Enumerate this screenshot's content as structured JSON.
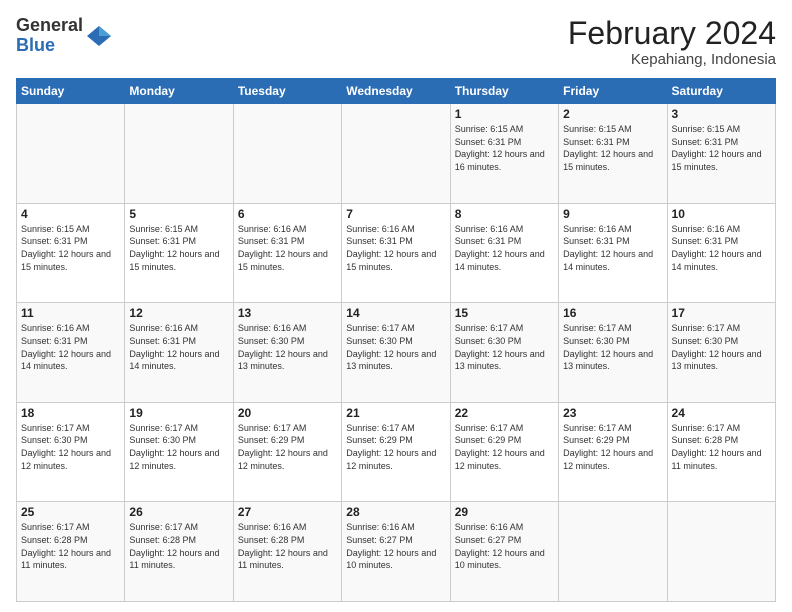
{
  "logo": {
    "text_general": "General",
    "text_blue": "Blue"
  },
  "title": "February 2024",
  "subtitle": "Kepahiang, Indonesia",
  "days_header": [
    "Sunday",
    "Monday",
    "Tuesday",
    "Wednesday",
    "Thursday",
    "Friday",
    "Saturday"
  ],
  "weeks": [
    [
      {
        "num": "",
        "info": ""
      },
      {
        "num": "",
        "info": ""
      },
      {
        "num": "",
        "info": ""
      },
      {
        "num": "",
        "info": ""
      },
      {
        "num": "1",
        "info": "Sunrise: 6:15 AM\nSunset: 6:31 PM\nDaylight: 12 hours and 16 minutes."
      },
      {
        "num": "2",
        "info": "Sunrise: 6:15 AM\nSunset: 6:31 PM\nDaylight: 12 hours and 15 minutes."
      },
      {
        "num": "3",
        "info": "Sunrise: 6:15 AM\nSunset: 6:31 PM\nDaylight: 12 hours and 15 minutes."
      }
    ],
    [
      {
        "num": "4",
        "info": "Sunrise: 6:15 AM\nSunset: 6:31 PM\nDaylight: 12 hours and 15 minutes."
      },
      {
        "num": "5",
        "info": "Sunrise: 6:15 AM\nSunset: 6:31 PM\nDaylight: 12 hours and 15 minutes."
      },
      {
        "num": "6",
        "info": "Sunrise: 6:16 AM\nSunset: 6:31 PM\nDaylight: 12 hours and 15 minutes."
      },
      {
        "num": "7",
        "info": "Sunrise: 6:16 AM\nSunset: 6:31 PM\nDaylight: 12 hours and 15 minutes."
      },
      {
        "num": "8",
        "info": "Sunrise: 6:16 AM\nSunset: 6:31 PM\nDaylight: 12 hours and 14 minutes."
      },
      {
        "num": "9",
        "info": "Sunrise: 6:16 AM\nSunset: 6:31 PM\nDaylight: 12 hours and 14 minutes."
      },
      {
        "num": "10",
        "info": "Sunrise: 6:16 AM\nSunset: 6:31 PM\nDaylight: 12 hours and 14 minutes."
      }
    ],
    [
      {
        "num": "11",
        "info": "Sunrise: 6:16 AM\nSunset: 6:31 PM\nDaylight: 12 hours and 14 minutes."
      },
      {
        "num": "12",
        "info": "Sunrise: 6:16 AM\nSunset: 6:31 PM\nDaylight: 12 hours and 14 minutes."
      },
      {
        "num": "13",
        "info": "Sunrise: 6:16 AM\nSunset: 6:30 PM\nDaylight: 12 hours and 13 minutes."
      },
      {
        "num": "14",
        "info": "Sunrise: 6:17 AM\nSunset: 6:30 PM\nDaylight: 12 hours and 13 minutes."
      },
      {
        "num": "15",
        "info": "Sunrise: 6:17 AM\nSunset: 6:30 PM\nDaylight: 12 hours and 13 minutes."
      },
      {
        "num": "16",
        "info": "Sunrise: 6:17 AM\nSunset: 6:30 PM\nDaylight: 12 hours and 13 minutes."
      },
      {
        "num": "17",
        "info": "Sunrise: 6:17 AM\nSunset: 6:30 PM\nDaylight: 12 hours and 13 minutes."
      }
    ],
    [
      {
        "num": "18",
        "info": "Sunrise: 6:17 AM\nSunset: 6:30 PM\nDaylight: 12 hours and 12 minutes."
      },
      {
        "num": "19",
        "info": "Sunrise: 6:17 AM\nSunset: 6:30 PM\nDaylight: 12 hours and 12 minutes."
      },
      {
        "num": "20",
        "info": "Sunrise: 6:17 AM\nSunset: 6:29 PM\nDaylight: 12 hours and 12 minutes."
      },
      {
        "num": "21",
        "info": "Sunrise: 6:17 AM\nSunset: 6:29 PM\nDaylight: 12 hours and 12 minutes."
      },
      {
        "num": "22",
        "info": "Sunrise: 6:17 AM\nSunset: 6:29 PM\nDaylight: 12 hours and 12 minutes."
      },
      {
        "num": "23",
        "info": "Sunrise: 6:17 AM\nSunset: 6:29 PM\nDaylight: 12 hours and 12 minutes."
      },
      {
        "num": "24",
        "info": "Sunrise: 6:17 AM\nSunset: 6:28 PM\nDaylight: 12 hours and 11 minutes."
      }
    ],
    [
      {
        "num": "25",
        "info": "Sunrise: 6:17 AM\nSunset: 6:28 PM\nDaylight: 12 hours and 11 minutes."
      },
      {
        "num": "26",
        "info": "Sunrise: 6:17 AM\nSunset: 6:28 PM\nDaylight: 12 hours and 11 minutes."
      },
      {
        "num": "27",
        "info": "Sunrise: 6:16 AM\nSunset: 6:28 PM\nDaylight: 12 hours and 11 minutes."
      },
      {
        "num": "28",
        "info": "Sunrise: 6:16 AM\nSunset: 6:27 PM\nDaylight: 12 hours and 10 minutes."
      },
      {
        "num": "29",
        "info": "Sunrise: 6:16 AM\nSunset: 6:27 PM\nDaylight: 12 hours and 10 minutes."
      },
      {
        "num": "",
        "info": ""
      },
      {
        "num": "",
        "info": ""
      }
    ]
  ]
}
